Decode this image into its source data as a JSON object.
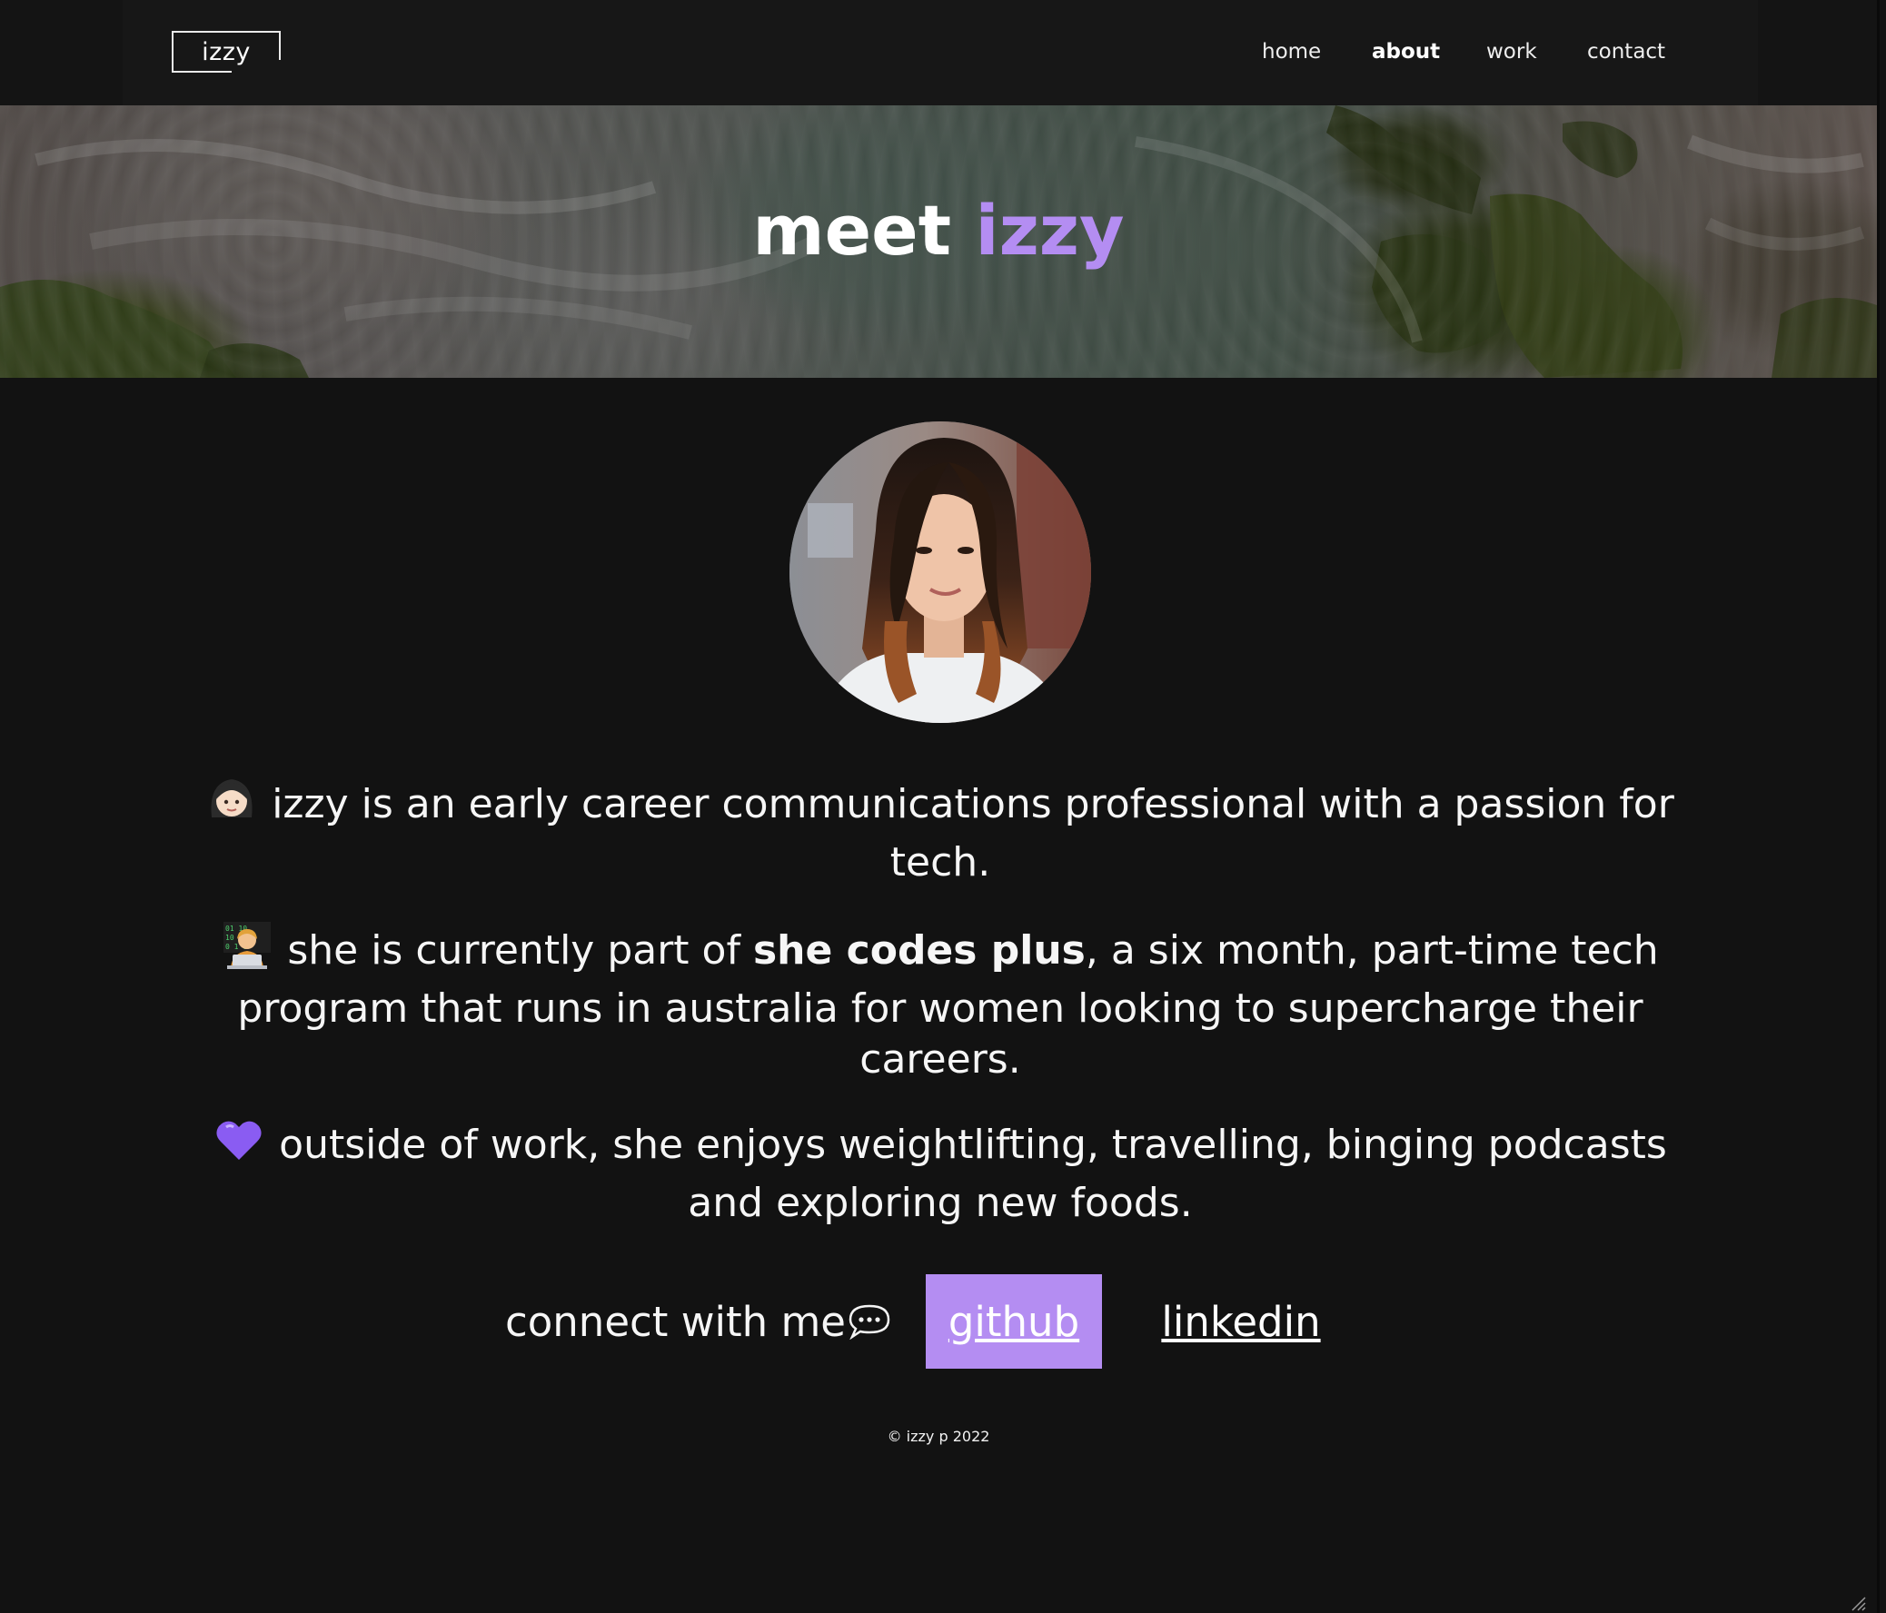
{
  "brand": {
    "logo_text": "izzy"
  },
  "nav": {
    "items": [
      {
        "label": "home",
        "active": false
      },
      {
        "label": "about",
        "active": true
      },
      {
        "label": "work",
        "active": false
      },
      {
        "label": "contact",
        "active": false
      }
    ]
  },
  "hero": {
    "title_plain": "meet",
    "title_accent": "izzy",
    "accent_color": "#b48df2"
  },
  "profile": {
    "avatar_alt": "portrait photo"
  },
  "bio": {
    "p1_icon": "woman-emoji",
    "p1_text": "izzy is an early career communications professional with a passion for tech.",
    "p2_icon": "woman-technologist-emoji",
    "p2_prefix": "she is currently part of ",
    "p2_bold": "she codes plus",
    "p2_suffix": ", a six month, part-time tech program that runs in australia for women looking to supercharge their careers.",
    "p3_icon": "purple-heart-emoji",
    "p3_text": "outside of work, she enjoys weightlifting, travelling, binging podcasts and exploring new foods."
  },
  "connect": {
    "label": "connect with me",
    "icon": "speech-bubble-icon",
    "github_label": "github",
    "linkedin_label": "linkedin"
  },
  "footer": {
    "copyright": "© izzy p 2022"
  },
  "colors": {
    "background": "#121212",
    "accent": "#b48df2",
    "text": "#ffffff"
  }
}
